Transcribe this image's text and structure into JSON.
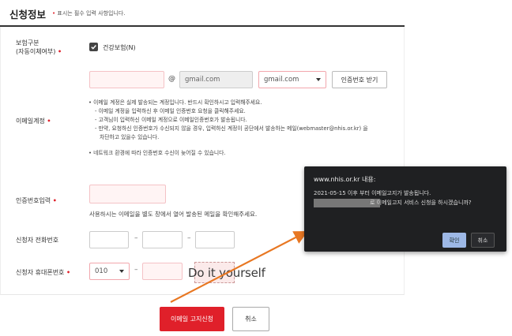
{
  "section": {
    "title": "신청정보",
    "required_note_mark": "•",
    "required_note": "표시는 필수 입력 사항입니다."
  },
  "insurance": {
    "label_line1": "보험구분",
    "label_line2": "(자동이체여부)",
    "checked": true,
    "option_label": "건강보험(N)"
  },
  "email": {
    "label": "이메일계정",
    "local_value": "",
    "at": "@",
    "domain_value": "gmail.com",
    "domain_select": "gmail.com",
    "request_button": "인증번호 받기",
    "notes": [
      "• 이메일 계정은 실제 발송되는 계정입니다. 반드시 확인하시고 입력해주세요.",
      "- 이메일 계정을 입력하신 후 이메일 인증번호 요청을 클릭해주세요.",
      "- 고객님이 입력하신 이메일 계정으로 이메일인증번호가 발송됩니다.",
      "- 만약, 요청하신 인증번호가 수신되지 않을 경우, 입력하신 계정이 공단에서 발송하는 메일(webmaster@nhis.or.kr) 을",
      "차단하고 있을수 있습니다.",
      "• 네트워크 환경에 따라 인증번호 수신이 늦어질 수 있습니다."
    ]
  },
  "auth": {
    "label": "인증번호입력",
    "value": "",
    "hint": "사용하시는 이메일을 별도 창에서 열어 발송된 메일을 확인해주세요."
  },
  "phone": {
    "label": "신청자 전화번호",
    "dash": "–"
  },
  "mobile": {
    "label": "신청자 휴대폰번호",
    "prefix": "010",
    "dash": "–",
    "overlay_text": "Do it yourself"
  },
  "actions": {
    "submit": "이메일 고지신청",
    "cancel": "취소"
  },
  "dialog": {
    "title": "www.nhis.or.kr 내용:",
    "line1": "2021-05-15 이후 부터 이메일고지가 발송됩니다.",
    "line2": "로 이메일고지 서비스 신청을 하시겠습니까?",
    "ok": "확인",
    "cancel": "취소"
  },
  "colors": {
    "accent_red": "#e0202a",
    "arrow_orange": "#e87722",
    "dialog_bg": "#1f2022",
    "dialog_ok": "#9db8e6"
  }
}
